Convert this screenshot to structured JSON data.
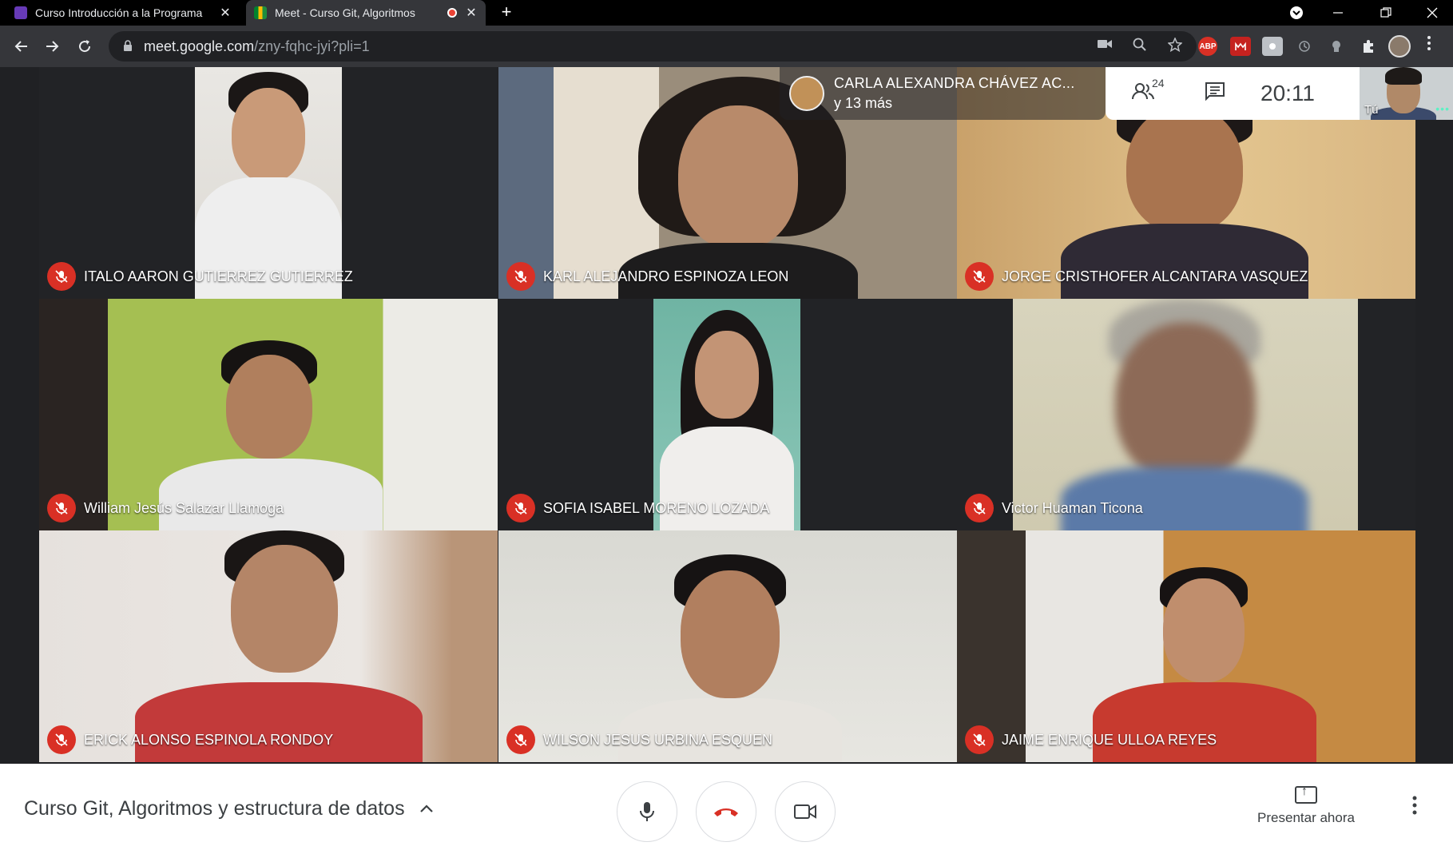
{
  "browser": {
    "tabs": [
      {
        "title": "Curso Introducción a la Programa",
        "close": "✕"
      },
      {
        "title": "Meet - Curso Git, Algoritmos",
        "close": "✕"
      }
    ],
    "new_tab": "+",
    "url_host": "meet.google.com",
    "url_path": "/zny-fqhc-jyi?pli=1",
    "extension_abp": "ABP"
  },
  "meet": {
    "active_speaker": {
      "name": "CARLA ALEXANDRA CHÁVEZ AC...",
      "more": "y 13 más"
    },
    "participant_count": "24",
    "clock": "20:11",
    "self_label": "Tú",
    "participants": [
      {
        "name": "ITALO AARON GUTIERREZ GUTIERREZ",
        "muted": true
      },
      {
        "name": "KARL ALEJANDRO ESPINOZA LEON",
        "muted": true
      },
      {
        "name": "JORGE CRISTHOFER ALCANTARA VASQUEZ",
        "muted": true
      },
      {
        "name": "William Jesús Salazar Llamoga",
        "muted": true
      },
      {
        "name": "SOFIA ISABEL MORENO LOZADA",
        "muted": true
      },
      {
        "name": "Victor Huaman Ticona",
        "muted": true
      },
      {
        "name": "ERICK ALONSO ESPINOLA RONDOY",
        "muted": true
      },
      {
        "name": "WILSON JESUS URBINA ESQUEN",
        "muted": true
      },
      {
        "name": "JAIME ENRIQUE ULLOA REYES",
        "muted": true
      }
    ],
    "meeting_title": "Curso Git, Algoritmos y estructura de datos",
    "present_label": "Presentar ahora"
  },
  "colors": {
    "mute_red": "#d93025",
    "stage_bg": "#202124",
    "hangup_red": "#d93025"
  }
}
